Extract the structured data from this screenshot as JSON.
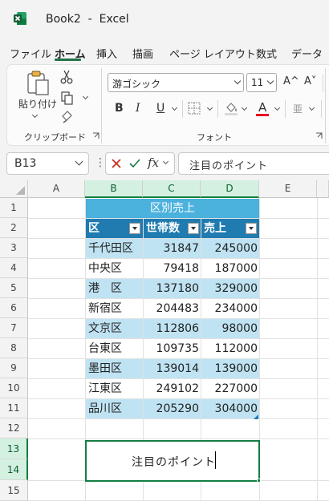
{
  "window": {
    "title": "Book2  -  Excel"
  },
  "colors": {
    "accent": "#217346",
    "table_header": "#1f7bb0",
    "table_title": "#4bb1dd",
    "band": "#bfe3f3",
    "selection": "#137e43"
  },
  "tabs": [
    "ファイル",
    "ホーム",
    "挿入",
    "描画",
    "ページ レイアウト",
    "数式",
    "データ"
  ],
  "active_tab": "ホーム",
  "ribbon": {
    "clipboard": {
      "paste_label": "貼り付け",
      "group_label": "クリップボード"
    },
    "font": {
      "font_name": "游ゴシック",
      "font_size": "11",
      "grow_label": "A^",
      "shrink_label": "A˅",
      "bold": "B",
      "italic": "I",
      "underline": "U",
      "font_color_label": "A",
      "phonetic_label": "亜",
      "group_label": "フォント"
    }
  },
  "formula_bar": {
    "name_box": "B13",
    "fx_label": "fx",
    "formula": "注目のポイント"
  },
  "grid": {
    "columns": [
      "A",
      "B",
      "C",
      "D",
      "E"
    ],
    "rows": [
      "1",
      "2",
      "3",
      "4",
      "5",
      "6",
      "7",
      "8",
      "9",
      "10",
      "11",
      "12",
      "13",
      "14",
      "15"
    ]
  },
  "table": {
    "title": "区別売上",
    "headers": [
      "区",
      "世帯数",
      "売上"
    ],
    "rows": [
      [
        "千代田区",
        "31847",
        "245000"
      ],
      [
        "中央区",
        "79418",
        "187000"
      ],
      [
        "港　区",
        "137180",
        "329000"
      ],
      [
        "新宿区",
        "204483",
        "234000"
      ],
      [
        "文京区",
        "112806",
        "98000"
      ],
      [
        "台東区",
        "109735",
        "112000"
      ],
      [
        "墨田区",
        "139014",
        "139000"
      ],
      [
        "江東区",
        "249102",
        "227000"
      ],
      [
        "品川区",
        "205290",
        "304000"
      ]
    ]
  },
  "note_cell": {
    "text": "注目のポイント"
  }
}
